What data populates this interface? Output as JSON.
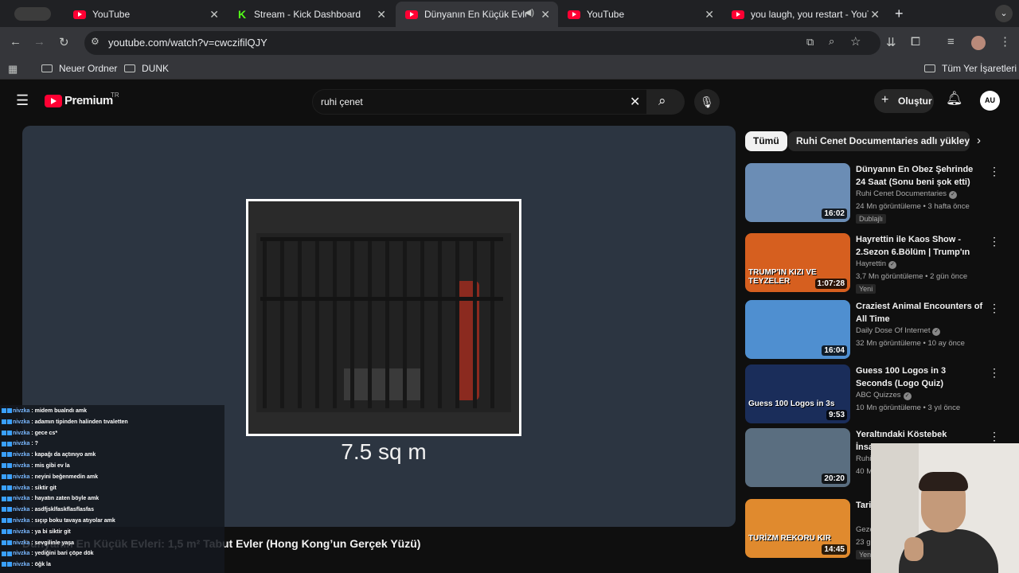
{
  "browser": {
    "tabs": [
      {
        "title": "YouTube",
        "type": "youtube"
      },
      {
        "title": "Stream - Kick Dashboard",
        "type": "kick"
      },
      {
        "title": "Dünyanın En Küçük Evleri",
        "type": "youtube",
        "active": true
      },
      {
        "title": "YouTube",
        "type": "youtube"
      },
      {
        "title": "you laugh, you restart - YouTube",
        "type": "youtube"
      }
    ],
    "url": "youtube.com/watch?v=cwczifilQJY",
    "bookmarks": [
      "Neuer Ordner",
      "DUNK"
    ],
    "all_bookmarks": "Tüm Yer İşaretleri"
  },
  "youtube": {
    "logo": "Premium",
    "region": "TR",
    "search_value": "ruhi çenet",
    "create_label": "Oluştur",
    "avatar_initials": "AU"
  },
  "video": {
    "overlay_caption": "7.5 sq m",
    "title": "Dünyanın En Küçük Evleri: 1,5 m² Tabut Evler (Hong Kong’un Gerçek Yüzü)"
  },
  "chat": [
    {
      "user": "nivzka",
      "text": "midem bualndı amk"
    },
    {
      "user": "nivzka",
      "text": "adamın tipinden halinden tıvaletten"
    },
    {
      "user": "nivzka",
      "text": "gece cs*"
    },
    {
      "user": "nivzka",
      "text": "?"
    },
    {
      "user": "nivzka",
      "text": "kapağı da açtınıyo amk"
    },
    {
      "user": "nivzka",
      "text": "mis gibi ev la"
    },
    {
      "user": "nivzka",
      "text": "neyini beğenmedin amk"
    },
    {
      "user": "nivzka",
      "text": "siktir git"
    },
    {
      "user": "nivzka",
      "text": "hayatın zaten böyle amk"
    },
    {
      "user": "nivzka",
      "text": "asdfjsklfaskflasflasfas"
    },
    {
      "user": "nivzka",
      "text": "sıçıp boku tavaya atıyolar amk"
    },
    {
      "user": "nivzka",
      "text": "ya bi siktir git"
    },
    {
      "user": "nivzka",
      "text": "sevgilinle yaşa"
    },
    {
      "user": "nivzka",
      "text": "yediğini bari çöpe dök"
    },
    {
      "user": "nivzka",
      "text": "öğk la"
    }
  ],
  "sidebar": {
    "chips": [
      "Tümü",
      "Ruhi Cenet Documentaries adlı yükleyiciden"
    ],
    "recs": [
      {
        "title": "Dünyanın En Obez Şehrinde 24 Saat (Sonu beni şok etti)",
        "channel": "Ruhi Cenet Documentaries",
        "meta": "24 Mn görüntüleme • 3 hafta önce",
        "badge": "Dublajlı",
        "duration": "16:02",
        "color": "#6b8db5"
      },
      {
        "title": "Hayrettin ile Kaos Show - 2.Sezon 6.Bölüm | Trump'ın Kı...",
        "channel": "Hayrettin",
        "meta": "3,7 Mn görüntüleme • 2 gün önce",
        "badge": "Yeni",
        "duration": "1:07:28",
        "color": "#d65f1f",
        "thumb_text": "TRUMP'IN KIZI VE TEYZELER"
      },
      {
        "title": "Craziest Animal Encounters of All Time",
        "channel": "Daily Dose Of Internet",
        "meta": "32 Mn görüntüleme • 10 ay önce",
        "badge": "",
        "duration": "16:04",
        "color": "#4f8fd0"
      },
      {
        "title": "Guess 100 Logos in 3 Seconds (Logo Quiz)",
        "channel": "ABC Quizzes",
        "meta": "10 Mn görüntüleme • 3 yıl önce",
        "badge": "",
        "duration": "9:53",
        "color": "#1a2d5a",
        "thumb_text": "Guess 100 Logos in 3s"
      },
      {
        "title": "Yeraltındaki Köstebek İnsanlara Yolculuk",
        "channel": "Ruhi",
        "meta": "40 Mn",
        "badge": "",
        "duration": "20:20",
        "color": "#5a6e80"
      },
      {
        "title": "Tarihi Gazi",
        "channel": "Geze",
        "meta": "23 g",
        "badge": "Yeni",
        "duration": "14:45",
        "color": "#e08a2e",
        "thumb_text": "TURİZM REKORU KIR"
      }
    ]
  }
}
